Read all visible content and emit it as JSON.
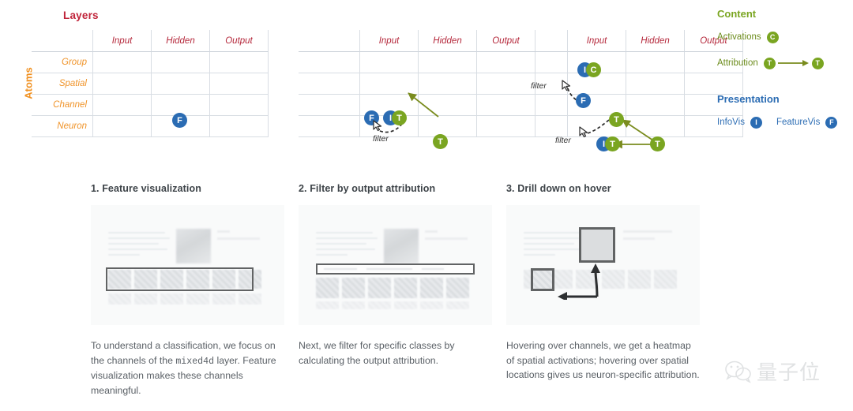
{
  "diagram": {
    "grid_title": "Layers",
    "axis_label_vertical": "Atoms",
    "columns": [
      "Input",
      "Hidden",
      "Output"
    ],
    "rows": [
      "Group",
      "Spatial",
      "Channel",
      "Neuron"
    ],
    "filter_label": "filter",
    "nodes": {
      "F": "F",
      "I": "I",
      "T": "T",
      "C": "C"
    }
  },
  "legend": {
    "content_title": "Content",
    "presentation_title": "Presentation",
    "activations_label": "Activations",
    "activations_badge": "C",
    "attribution_label": "Attribution",
    "attribution_badge_from": "T",
    "attribution_badge_to": "T",
    "infovis_label": "InfoVis",
    "infovis_badge": "I",
    "featurevis_label": "FeatureVis",
    "featurevis_badge": "F"
  },
  "panels": [
    {
      "heading": "1. Feature visualization",
      "caption_part1": "To understand a classification, we focus on the channels of the ",
      "caption_code": "mixed4d",
      "caption_part2": " layer. Feature visualization makes these channels meaningful."
    },
    {
      "heading": "2. Filter by output attribution",
      "caption_part1": "Next, we filter for specific classes by calculating the output attribution.",
      "caption_code": "",
      "caption_part2": ""
    },
    {
      "heading": "3. Drill down on hover",
      "caption_part1": "Hovering over channels, we get a heatmap of spatial activations; hovering over spatial locations gives us neuron-specific attribution.",
      "caption_code": "",
      "caption_part2": ""
    }
  ],
  "watermark": {
    "text": "量子位",
    "icon": "wechat-icon"
  },
  "colors": {
    "title_red": "#c0243a",
    "column_header_red": "#b5293c",
    "row_header_orange": "#f0942a",
    "atoms_orange": "#f09020",
    "node_blue": "#2b6cb3",
    "node_green": "#7aa521",
    "content_green": "#7aa521",
    "presentation_blue": "#2b6cb3",
    "grid_line": "#d8dde3"
  }
}
